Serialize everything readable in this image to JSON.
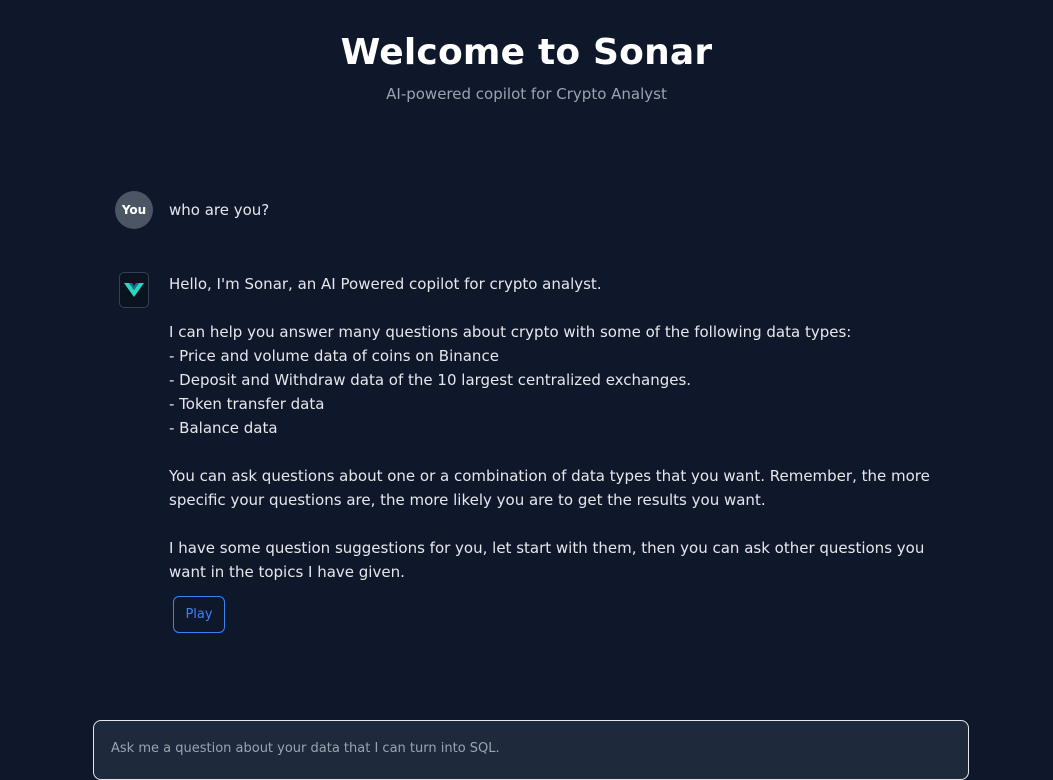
{
  "header": {
    "title": "Welcome to Sonar",
    "subtitle": "AI-powered copilot for Crypto Analyst"
  },
  "conversation": {
    "user": {
      "avatar_label": "You",
      "text": "who are you?"
    },
    "bot": {
      "avatar_icon": "sonar-logo-icon",
      "lines": [
        "Hello, I'm Sonar, an AI Powered copilot for crypto analyst.",
        "",
        "I can help you answer many questions about crypto with some of the following data types:",
        "- Price and volume data of coins on Binance",
        "- Deposit and Withdraw data of the 10 largest centralized exchanges.",
        "- Token transfer data",
        "- Balance data",
        "",
        "You can ask questions about one or a combination of data types that you want. Remember, the more specific your questions are, the more likely you are to get the results you want.",
        "",
        "I have some question suggestions for you, let start with them, then you can ask other questions you want in the topics I have given."
      ],
      "play_label": "Play"
    }
  },
  "input": {
    "placeholder": "Ask me a question about your data that I can turn into SQL.",
    "value": ""
  },
  "colors": {
    "background": "#0f172a",
    "accent": "#3b82f6",
    "logo": "#2dd4bf"
  }
}
